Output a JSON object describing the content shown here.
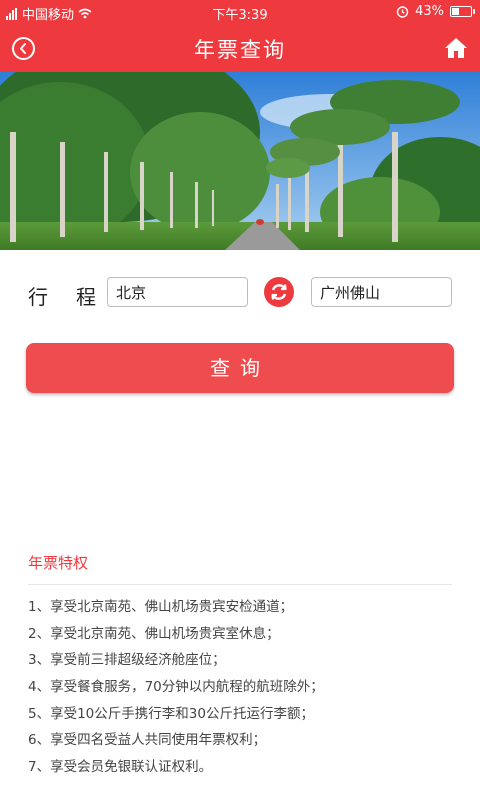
{
  "status_bar": {
    "carrier": "中国移动",
    "time": "下午3:39",
    "battery": "43%",
    "battery_level": 0.43
  },
  "header": {
    "title": "年票查询",
    "back_icon": "back-circle-icon",
    "home_icon": "home-icon"
  },
  "banner": {
    "description_icon": "palm-tree-avenue-photo"
  },
  "route": {
    "label_chars": [
      "行",
      "程"
    ],
    "from": "北京",
    "to": "广州佛山",
    "swap_icon": "swap-refresh-icon"
  },
  "query_button": {
    "label": "查询"
  },
  "privileges": {
    "title": "年票特权",
    "items": [
      "1、享受北京南苑、佛山机场贵宾安检通道；",
      "2、享受北京南苑、佛山机场贵宾室休息；",
      "3、享受前三排超级经济舱座位；",
      "4、享受餐食服务，70分钟以内航程的航班除外；",
      "5、享受10公斤手携行李和30公斤托运行李额；",
      "6、享受四名受益人共同使用年票权利；",
      "7、享受会员免银联认证权利。"
    ]
  },
  "colors": {
    "brand_red": "#ee3a3e",
    "button_red": "#ee4c4f"
  }
}
